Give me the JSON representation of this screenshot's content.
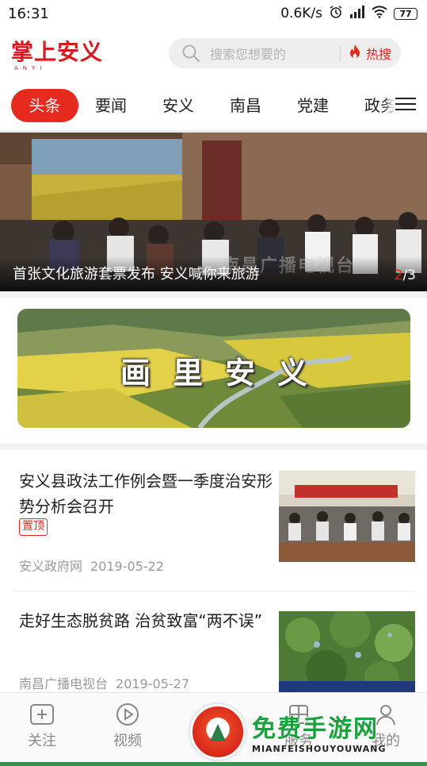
{
  "status_bar": {
    "time": "16:31",
    "network_speed": "0.6K/s",
    "battery": "77"
  },
  "header": {
    "logo_text": "掌上安义",
    "logo_sub": "ANYI",
    "search_placeholder": "搜索您想要的",
    "hot_search_label": "热搜"
  },
  "tabs": [
    {
      "label": "头条",
      "active": true
    },
    {
      "label": "要闻",
      "active": false
    },
    {
      "label": "安义",
      "active": false
    },
    {
      "label": "南昌",
      "active": false
    },
    {
      "label": "党建",
      "active": false
    },
    {
      "label": "政务",
      "active": false
    }
  ],
  "banner": {
    "title": "首张文化旅游套票发布 安义喊你来旅游",
    "current_page": "2",
    "total_pages": "/3",
    "watermark": "南昌广播电视台"
  },
  "promo": {
    "title": "画里安义"
  },
  "news": [
    {
      "title": "安义县政法工作例会暨一季度治安形势分析会召开",
      "badge": "置顶",
      "source": "安义政府网",
      "date": "2019-05-22"
    },
    {
      "title": "走好生态脱贫路 治贫致富“两不误”",
      "badge": "",
      "source": "南昌广播电视台",
      "date": "2019-05-27"
    }
  ],
  "bottom_nav": {
    "items": [
      {
        "label": "关注",
        "icon": "plus-square-icon"
      },
      {
        "label": "视频",
        "icon": "play-circle-icon"
      },
      {
        "label": "服务",
        "icon": "grid-icon"
      },
      {
        "label": "我的",
        "icon": "person-icon"
      }
    ]
  },
  "overlay_badge": {
    "name": "免费手游网",
    "sub": "MIANFEISHOUYOUWANG"
  },
  "colors": {
    "accent": "#e52a1e",
    "text_primary": "#222222",
    "text_secondary": "#9a9a9a"
  }
}
